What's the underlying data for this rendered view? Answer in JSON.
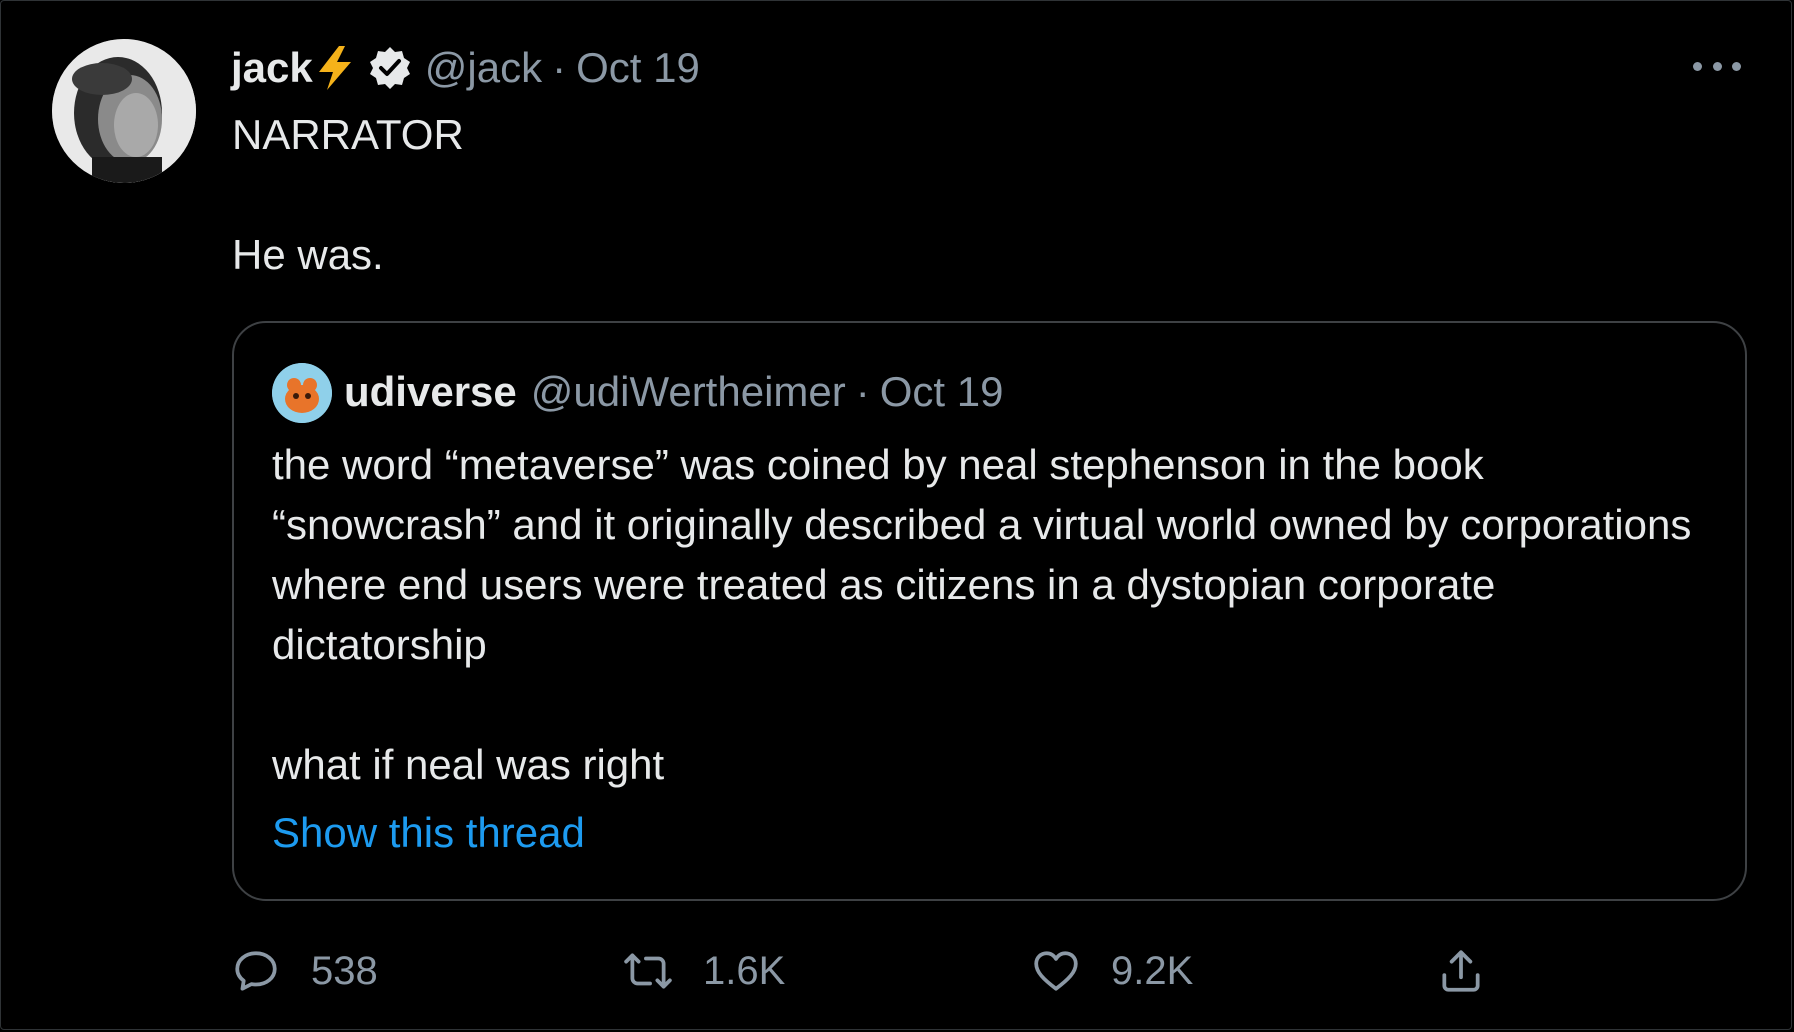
{
  "tweet": {
    "author_name": "jack",
    "author_emoji": "⚡",
    "handle": "@jack",
    "separator": "·",
    "date": "Oct 19",
    "lines": [
      "NARRATOR",
      "He was."
    ],
    "avatar_icon": "profile-photo"
  },
  "quoted": {
    "author_name": "udiverse",
    "handle": "@udiWertheimer",
    "separator": "·",
    "date": "Oct 19",
    "paragraphs": [
      "the word “metaverse” was coined by neal stephenson in the book “snowcrash” and it originally described a virtual world owned by corporations where end users were treated as citizens in a dystopian corporate dictatorship",
      "what if neal was right"
    ],
    "show_thread_label": "Show this thread"
  },
  "actions": {
    "reply_count": "538",
    "retweet_count": "1.6K",
    "like_count": "9.2K",
    "icons": [
      "reply-icon",
      "retweet-icon",
      "like-icon",
      "share-icon"
    ]
  },
  "colors": {
    "background": "#000000",
    "text_primary": "#e7e9ea",
    "text_secondary": "#8b98a5",
    "link": "#1d9bf0",
    "border": "#3e4144",
    "bolt": "#f5b21a"
  }
}
